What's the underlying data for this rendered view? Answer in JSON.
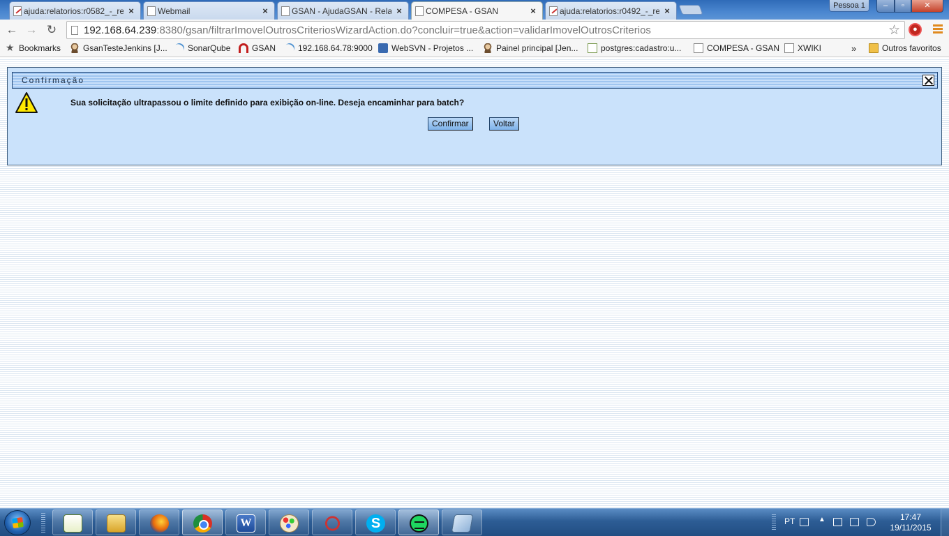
{
  "browser": {
    "tabs": [
      {
        "title": "ajuda:relatorios:r0582_-_re",
        "icon": "edit-page-icon",
        "active": false
      },
      {
        "title": "Webmail",
        "icon": "page-icon",
        "active": false
      },
      {
        "title": "GSAN - AjudaGSAN - Rela",
        "icon": "page-icon",
        "active": false
      },
      {
        "title": "COMPESA - GSAN",
        "icon": "page-icon",
        "active": true
      },
      {
        "title": "ajuda:relatorios:r0492_-_re",
        "icon": "edit-page-icon",
        "active": false
      }
    ],
    "tab_close_glyph": "×",
    "profile_label": "Pessoa 1",
    "window_buttons": {
      "minimize": "–",
      "maximize": "▫",
      "close": "✕"
    },
    "nav": {
      "back": "←",
      "forward": "→",
      "reload": "↻"
    },
    "url": {
      "host": "192.168.64.239",
      "rest": ":8380/gsan/filtrarImovelOutrosCriteriosWizardAction.do?concluir=true&action=validarImovelOutrosCriterios"
    },
    "star_glyph": "☆",
    "bookmarks": [
      {
        "label": "Bookmarks",
        "icon": "star-icon"
      },
      {
        "label": "GsanTesteJenkins [J...",
        "icon": "jenkins-icon"
      },
      {
        "label": "SonarQube",
        "icon": "sonarqube-icon"
      },
      {
        "label": "GSAN",
        "icon": "gsan-icon"
      },
      {
        "label": "192.168.64.78:9000",
        "icon": "sonarqube-icon"
      },
      {
        "label": "WebSVN - Projetos ...",
        "icon": "websvn-icon"
      },
      {
        "label": "Painel principal [Jen...",
        "icon": "jenkins-icon"
      },
      {
        "label": "postgres:cadastro:u...",
        "icon": "edit-page-icon"
      },
      {
        "label": "COMPESA - GSAN",
        "icon": "page-icon"
      },
      {
        "label": "XWIKI",
        "icon": "page-icon"
      }
    ],
    "bookmarks_overflow": "»",
    "other_bookmarks": "Outros favoritos"
  },
  "dialog": {
    "title": "Confirmação",
    "message": "Sua solicitação ultrapassou o limite definido para exibição on-line. Deseja encaminhar para batch?",
    "confirm_label": "Confirmar",
    "back_label": "Voltar",
    "colors": {
      "background": "#cae2fb",
      "header_stripe": "#9fc5f0",
      "border": "#3c5a7a"
    }
  },
  "taskbar": {
    "apps": [
      {
        "name": "notepad-plus",
        "icon": "notepad-icon"
      },
      {
        "name": "explorer",
        "icon": "folder-icon"
      },
      {
        "name": "firefox",
        "icon": "firefox-icon"
      },
      {
        "name": "chrome",
        "icon": "chrome-icon",
        "running": true
      },
      {
        "name": "word",
        "icon": "word-icon",
        "glyph": "W"
      },
      {
        "name": "paint",
        "icon": "paint-icon"
      },
      {
        "name": "snipping-tool",
        "icon": "snipping-icon"
      },
      {
        "name": "skype",
        "icon": "skype-icon",
        "glyph": "S"
      },
      {
        "name": "spotify",
        "icon": "spotify-icon",
        "running": true
      },
      {
        "name": "app",
        "icon": "app-icon"
      }
    ],
    "tray": {
      "language": "PT",
      "up_arrow": "▲"
    },
    "clock": {
      "time": "17:47",
      "date": "19/11/2015"
    }
  }
}
